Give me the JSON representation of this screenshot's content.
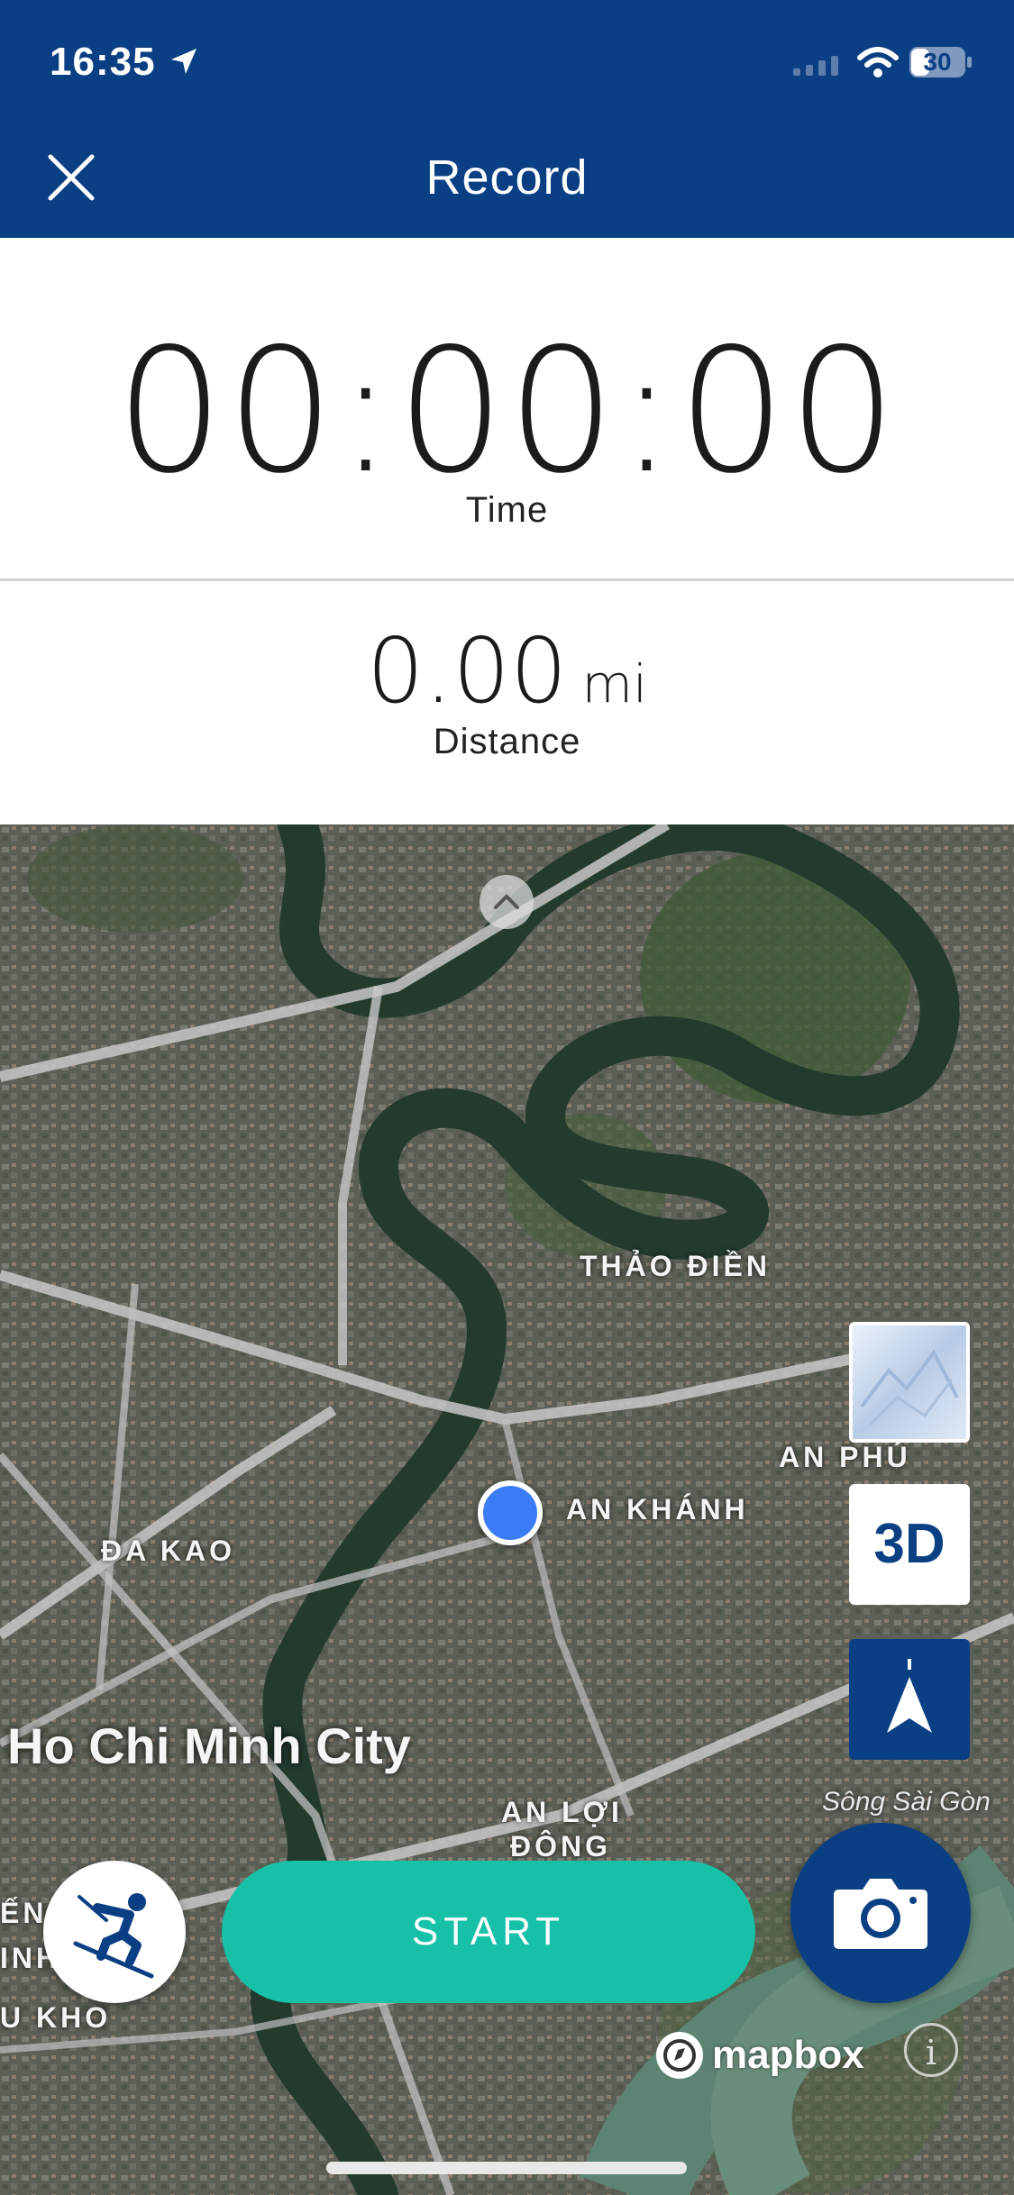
{
  "status_bar": {
    "time": "16:35",
    "battery": "30"
  },
  "header": {
    "title": "Record"
  },
  "stats": {
    "time_value": "00:00:00",
    "time_label": "Time",
    "distance_value": "0.00",
    "distance_unit": "mi",
    "distance_label": "Distance"
  },
  "map": {
    "labels": {
      "thao_dien": "THẢO ĐIỀN",
      "an_phu": "AN PHÚ",
      "an_khanh": "AN KHÁNH",
      "da_kao": "ĐA KAO",
      "city": "Ho Chi Minh City",
      "an_loi_dong_1": "AN LỢI",
      "an_loi_dong_2": "ĐÔNG",
      "song_sai_gon": "Sông Sài Gòn",
      "edge_1": "ẾN",
      "edge_2": "INH",
      "edge_3": "U KHO"
    },
    "buttons": {
      "btn_3d": "3D",
      "start": "START"
    },
    "attribution": "mapbox",
    "info_glyph": "i"
  },
  "colors": {
    "header": "#0a3f84",
    "start": "#16c1a8",
    "user_location": "#3b7cf6"
  }
}
